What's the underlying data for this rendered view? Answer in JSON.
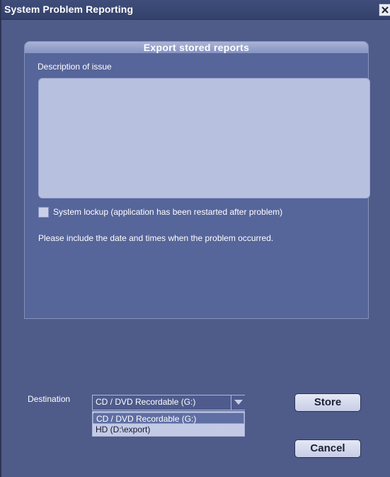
{
  "window": {
    "title": "System Problem Reporting"
  },
  "panel": {
    "title": "Export stored reports",
    "description_label": "Description of issue",
    "description_value": "",
    "lockup_checkbox": {
      "label": "System lockup (application has been restarted after problem)",
      "checked": false
    },
    "note": "Please include the date and times when the problem occurred."
  },
  "destination": {
    "label": "Destination",
    "selected": "CD / DVD Recordable   (G:)",
    "options": [
      "CD / DVD Recordable   (G:)",
      "HD    (D:\\export)"
    ]
  },
  "buttons": {
    "store": "Store",
    "cancel": "Cancel"
  },
  "icons": {
    "close": "close-icon",
    "dropdown": "chevron-down-icon"
  }
}
